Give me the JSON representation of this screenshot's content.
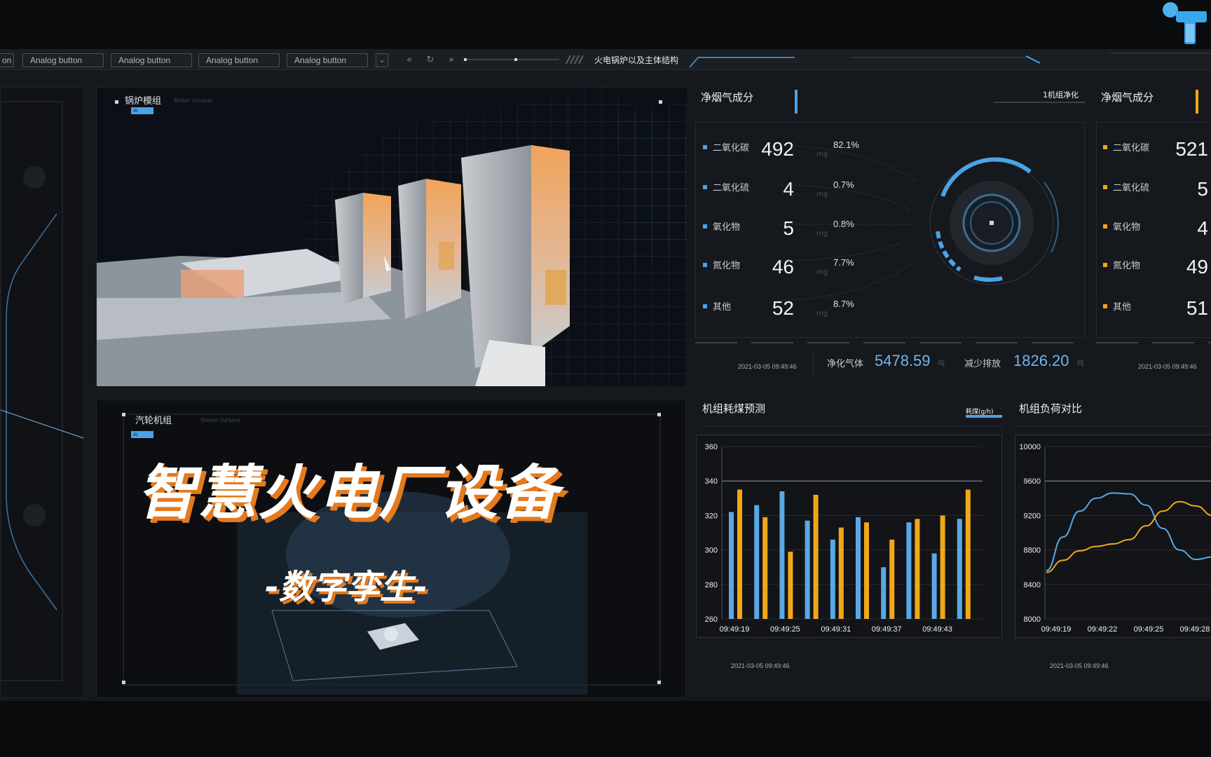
{
  "toolbar": {
    "partial_label": "on",
    "buttons": [
      "Analog button",
      "Analog button",
      "Analog button",
      "Analog button"
    ],
    "title": "火电锅炉以及主体结构"
  },
  "boiler_panel": {
    "label": "锅炉模组",
    "sub": "Boiler module",
    "tag": "AI"
  },
  "turbine_panel": {
    "label": "汽轮机组",
    "sub": "Steam turbine",
    "tag": "AI"
  },
  "overlay": {
    "headline": "智慧火电厂设备",
    "subline": "-数字孪生-"
  },
  "flue_gas_1": {
    "title": "净烟气成分",
    "badge": "1机组净化",
    "items": [
      {
        "name": "二氧化碳",
        "value": "492",
        "unit": "mg",
        "pct": "82.1%"
      },
      {
        "name": "二氧化硫",
        "value": "4",
        "unit": "mg",
        "pct": "0.7%"
      },
      {
        "name": "氧化物",
        "value": "5",
        "unit": "mg",
        "pct": "0.8%"
      },
      {
        "name": "氮化物",
        "value": "46",
        "unit": "mg",
        "pct": "7.7%"
      },
      {
        "name": "其他",
        "value": "52",
        "unit": "mg",
        "pct": "8.7%"
      }
    ],
    "timestamp": "2021-03-05 09:49:46",
    "purified_label": "净化气体",
    "purified_value": "5478.59",
    "purified_unit": "吨",
    "reduced_label": "减少排放",
    "reduced_value": "1826.20",
    "reduced_unit": "吨"
  },
  "flue_gas_2": {
    "title": "净烟气成分",
    "items": [
      {
        "name": "二氧化碳",
        "value": "521"
      },
      {
        "name": "二氧化硫",
        "value": "5"
      },
      {
        "name": "氧化物",
        "value": "4"
      },
      {
        "name": "氮化物",
        "value": "49"
      },
      {
        "name": "其他",
        "value": "51"
      }
    ],
    "timestamp": "2021-03-05 09:49:46"
  },
  "coal_chart": {
    "title": "机组耗煤预测",
    "legend": "耗煤(g/h)",
    "timestamp": "2021-03-05 09:49:46"
  },
  "load_chart": {
    "title": "机组负荷对比",
    "timestamp": "2021-03-05 09:49:46"
  },
  "colors": {
    "blue": "#5aa8e6",
    "orange": "#f0a818",
    "accent_orange": "#e57a1d"
  },
  "chart_data": [
    {
      "type": "bar",
      "title": "机组耗煤预测",
      "yticks": [
        260,
        280,
        300,
        320,
        340,
        360
      ],
      "ylim": [
        260,
        360
      ],
      "x_tick_labels": [
        "09:49:19",
        "09:49:25",
        "09:49:31",
        "09:49:37",
        "09:49:43"
      ],
      "series": [
        {
          "color": "#5aa8e6",
          "values": [
            322,
            326,
            334,
            317,
            306,
            319,
            290,
            316,
            298,
            318
          ]
        },
        {
          "color": "#f0a818",
          "values": [
            335,
            319,
            299,
            332,
            313,
            316,
            306,
            318,
            320,
            335
          ]
        }
      ]
    },
    {
      "type": "line",
      "title": "机组负荷对比",
      "yticks": [
        8000,
        8400,
        8800,
        9200,
        9600,
        10000
      ],
      "ylim": [
        8000,
        10000
      ],
      "x": [
        0,
        1,
        2,
        3,
        4,
        5,
        6,
        7,
        8,
        9,
        10
      ],
      "x_tick_labels": [
        "09:49:19",
        "09:49:22",
        "09:49:25",
        "09:49:28"
      ],
      "series": [
        {
          "color": "#5aa8e6",
          "values": [
            8560,
            8950,
            9250,
            9400,
            9460,
            9450,
            9320,
            9050,
            8800,
            8690,
            8720
          ]
        },
        {
          "color": "#f0a818",
          "values": [
            8540,
            8680,
            8790,
            8840,
            8870,
            8920,
            9080,
            9250,
            9360,
            9310,
            9200
          ]
        }
      ]
    }
  ]
}
